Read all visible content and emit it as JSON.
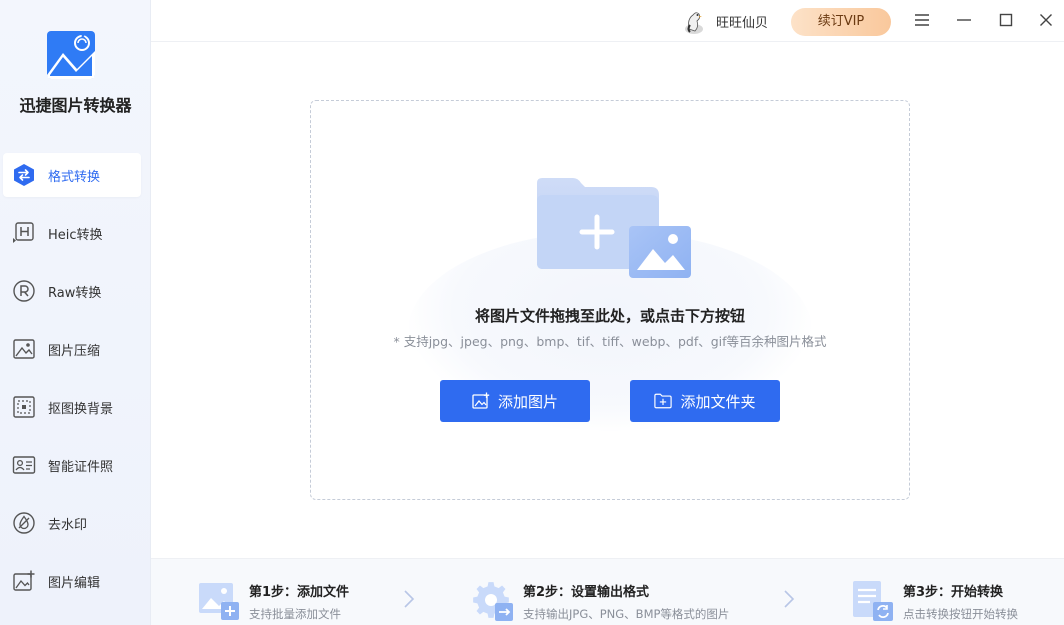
{
  "app": {
    "name": "迅捷图片转换器"
  },
  "sidebar": {
    "items": [
      {
        "label": "格式转换",
        "icon": "swap-arrows-icon",
        "active": true
      },
      {
        "label": "Heic转换",
        "icon": "heic-icon",
        "active": false
      },
      {
        "label": "Raw转换",
        "icon": "raw-icon",
        "active": false
      },
      {
        "label": "图片压缩",
        "icon": "image-compress-icon",
        "active": false
      },
      {
        "label": "抠图换背景",
        "icon": "cutout-background-icon",
        "active": false
      },
      {
        "label": "智能证件照",
        "icon": "id-photo-icon",
        "active": false
      },
      {
        "label": "去水印",
        "icon": "remove-watermark-icon",
        "active": false
      },
      {
        "label": "图片编辑",
        "icon": "image-edit-icon",
        "active": false
      }
    ]
  },
  "header": {
    "username": "旺旺仙贝",
    "vip_label": "续订VIP"
  },
  "dropzone": {
    "title": "将图片文件拖拽至此处，或点击下方按钮",
    "subtitle": "* 支持jpg、jpeg、png、bmp、tif、tiff、webp、pdf、gif等百余种图片格式",
    "add_image_label": "添加图片",
    "add_folder_label": "添加文件夹"
  },
  "steps": [
    {
      "title": "第1步：添加文件",
      "desc": "支持批量添加文件"
    },
    {
      "title": "第2步：设置输出格式",
      "desc": "支持输出JPG、PNG、BMP等格式的图片"
    },
    {
      "title": "第3步：开始转换",
      "desc": "点击转换按钮开始转换"
    }
  ],
  "colors": {
    "accent": "#2f6bf0",
    "vip_gradient_start": "#fde2c8",
    "vip_gradient_end": "#f9c89c"
  }
}
